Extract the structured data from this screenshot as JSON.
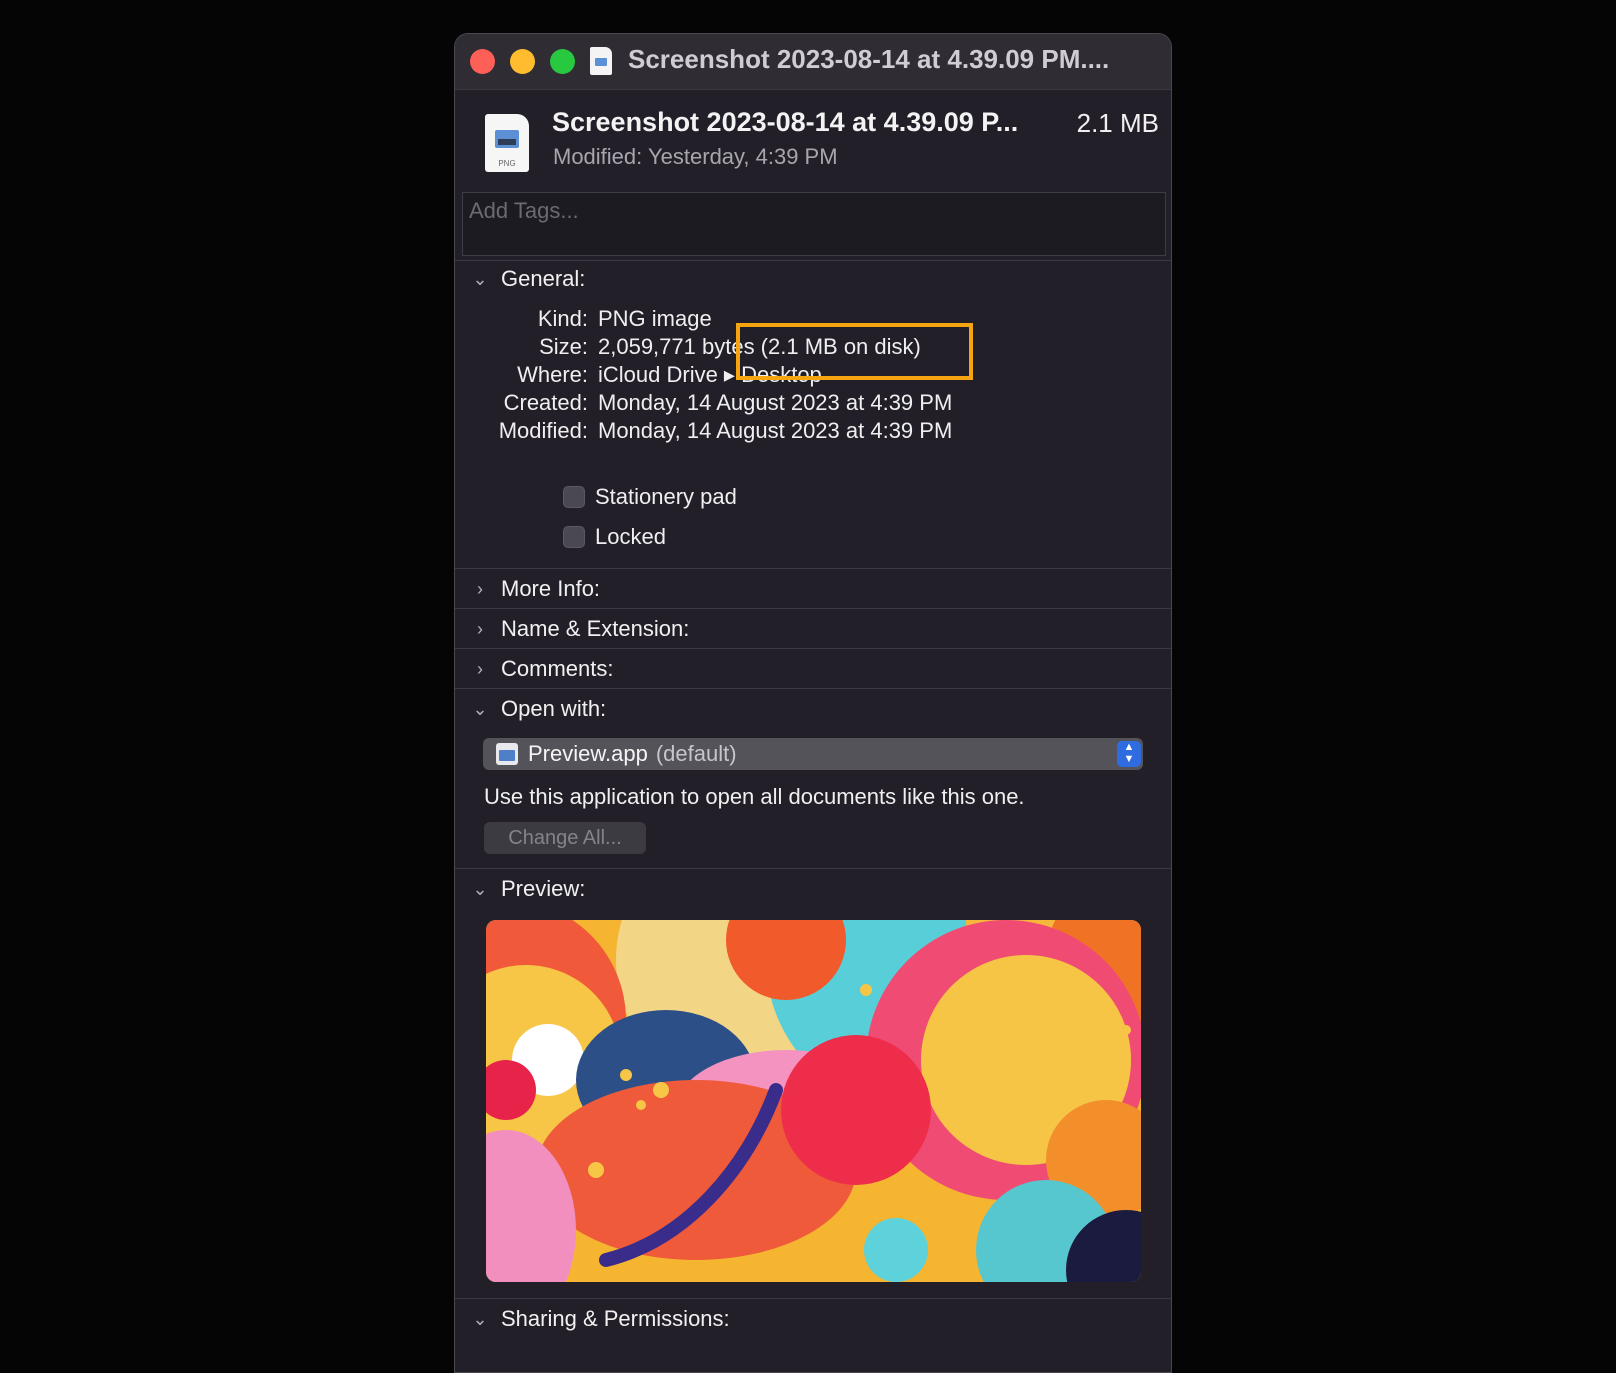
{
  "window": {
    "title": "Screenshot 2023-08-14 at 4.39.09 PM...."
  },
  "header": {
    "file_name": "Screenshot 2023-08-14 at 4.39.09 P...",
    "file_size": "2.1 MB",
    "modified_label": "Modified:",
    "modified_value": "Yesterday, 4:39 PM",
    "file_type_badge": "PNG"
  },
  "tags": {
    "placeholder": "Add Tags..."
  },
  "general": {
    "title": "General:",
    "rows": [
      {
        "label": "Kind:",
        "value": "PNG image"
      },
      {
        "label": "Size:",
        "value": "2,059,771 bytes (2.1 MB on disk)"
      },
      {
        "label": "Where:",
        "value": "iCloud Drive ▸ Desktop"
      },
      {
        "label": "Created:",
        "value": "Monday, 14 August 2023 at 4:39 PM"
      },
      {
        "label": "Modified:",
        "value": "Monday, 14 August 2023 at 4:39 PM"
      }
    ],
    "checkboxes": [
      {
        "label": "Stationery pad",
        "checked": false
      },
      {
        "label": "Locked",
        "checked": false
      }
    ]
  },
  "sections": {
    "more_info": "More Info:",
    "name_ext": "Name & Extension:",
    "comments": "Comments:",
    "open_with": "Open with:",
    "preview": "Preview:",
    "sharing": "Sharing & Permissions:"
  },
  "open_with": {
    "app_name": "Preview.app",
    "app_default": "(default)",
    "description": "Use this application to open all documents like this one.",
    "change_all": "Change All..."
  },
  "colors": {
    "window_bg": "#221f29",
    "highlight": "#f4a50f",
    "accent_blue": "#2f6ce0"
  }
}
